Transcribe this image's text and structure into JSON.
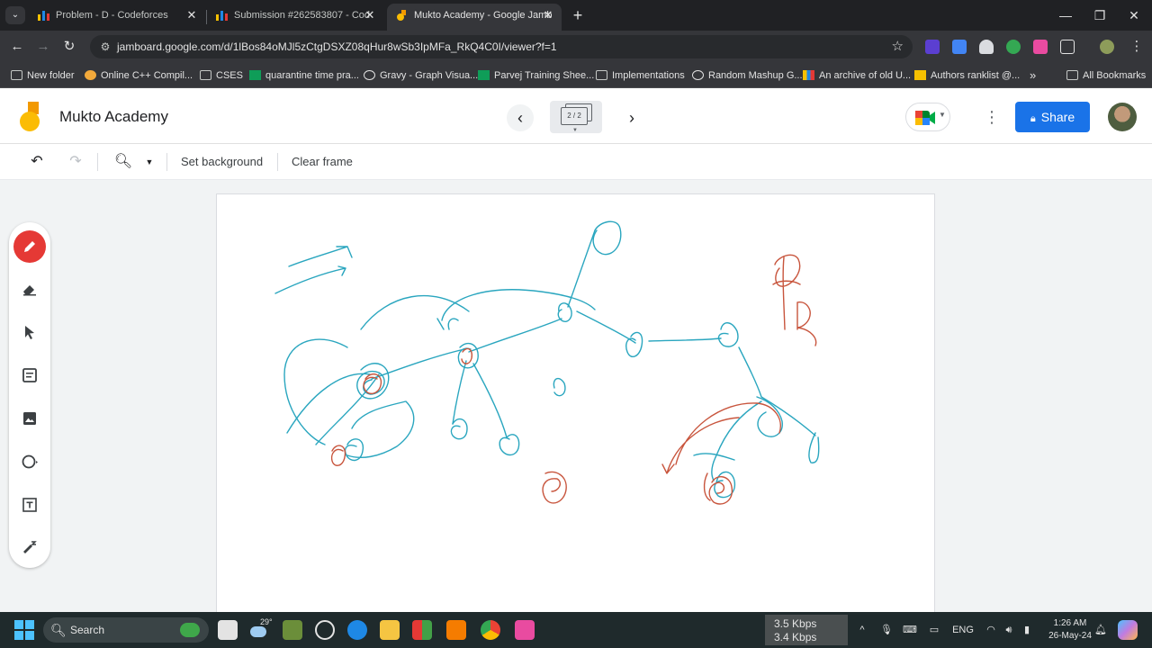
{
  "browser": {
    "tabs": [
      {
        "title": "Problem - D - Codeforces",
        "active": false
      },
      {
        "title": "Submission #262583807 - Cod",
        "active": false
      },
      {
        "title": "Mukto Academy - Google Jamb",
        "active": true
      }
    ],
    "url": "jamboard.google.com/d/1lBos84oMJl5zCtgDSXZ08qHur8wSb3IpMFa_RkQ4C0I/viewer?f=1",
    "bookmarks": [
      {
        "label": "New folder",
        "icon": "folder-icon"
      },
      {
        "label": "Online C++ Compil...",
        "icon": "compiler-icon"
      },
      {
        "label": "CSES",
        "icon": "folder-icon"
      },
      {
        "label": "quarantine time pra...",
        "icon": "sheets-icon"
      },
      {
        "label": "Gravy - Graph Visua...",
        "icon": "globe-icon"
      },
      {
        "label": "Parvej Training Shee...",
        "icon": "sheets-icon"
      },
      {
        "label": "Implementations",
        "icon": "folder-icon"
      },
      {
        "label": "Random Mashup G...",
        "icon": "globe-icon"
      },
      {
        "label": "An archive of old U...",
        "icon": "chart-icon"
      },
      {
        "label": "Authors ranklist @...",
        "icon": "authors-icon"
      }
    ],
    "all_bookmarks": "All Bookmarks",
    "more_bookmarks": "»"
  },
  "jamboard": {
    "title": "Mukto Academy",
    "frame_indicator": "2 / 2",
    "share_label": "Share",
    "toolbar": {
      "set_background": "Set background",
      "clear_frame": "Clear frame"
    }
  },
  "taskbar": {
    "search_label": "Search",
    "weather_temp": "29°",
    "net_up": "3.5 Kbps",
    "net_down": "3.4 Kbps",
    "language": "ENG",
    "time": "1:26 AM",
    "date": "26-May-24"
  },
  "colors": {
    "teal_ink": "#2aa6bf",
    "red_ink": "#c8553d",
    "share_blue": "#1a73e8",
    "pen_red": "#e53935"
  }
}
